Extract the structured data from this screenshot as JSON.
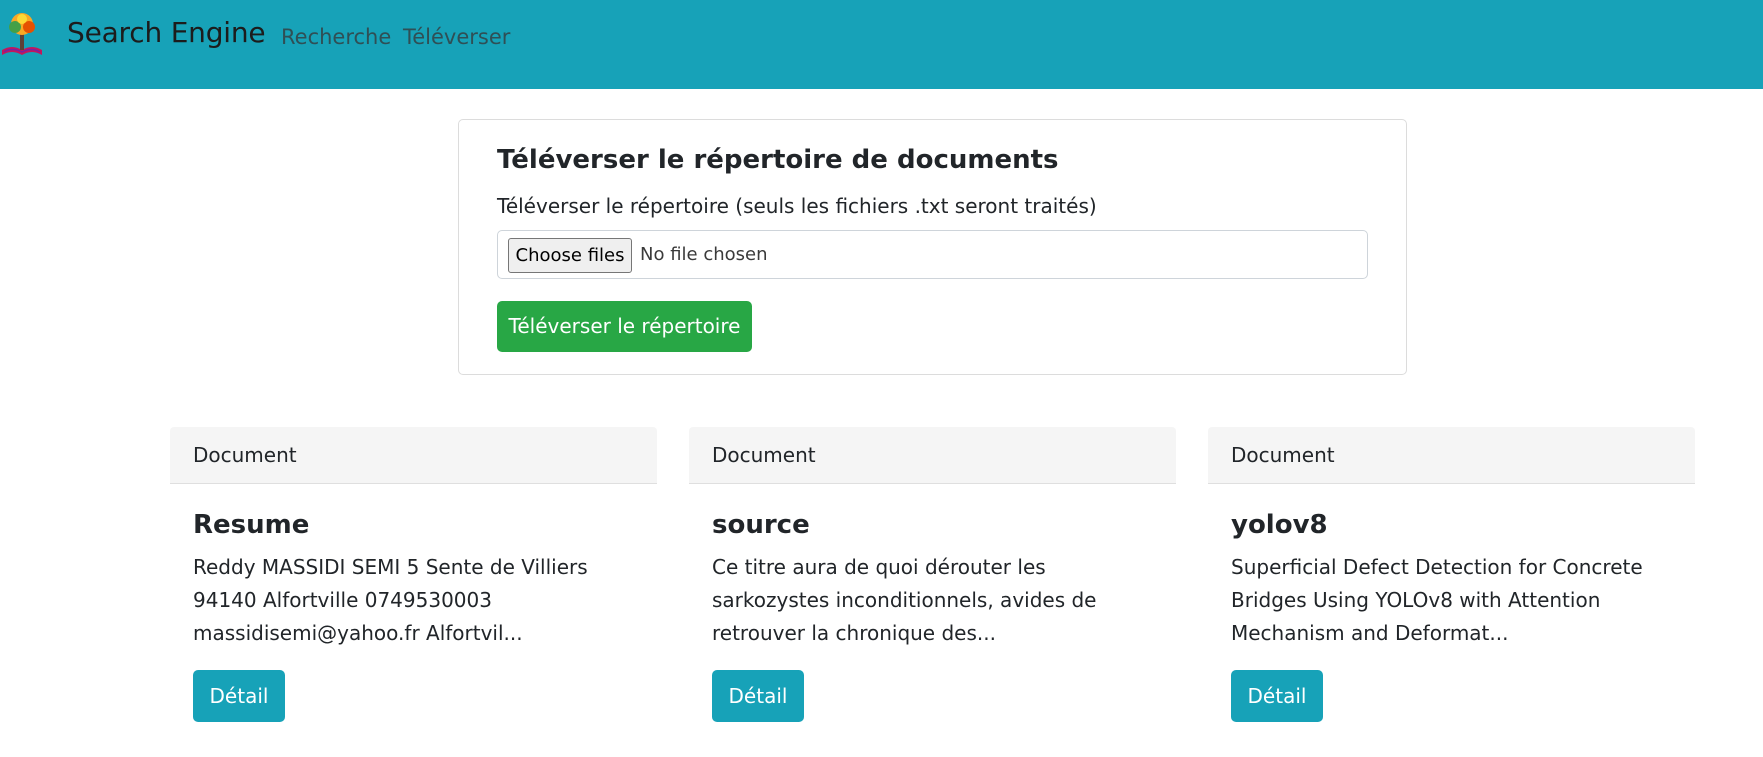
{
  "navbar": {
    "brand": "Search Engine",
    "logo_icon": "tree-book-logo",
    "links": [
      {
        "label": "Recherche"
      },
      {
        "label": "Téléverser"
      }
    ],
    "background_color": "#17a2b8"
  },
  "upload": {
    "title": "Téléverser le répertoire de documents",
    "label": "Téléverser le répertoire (seuls les fichiers .txt seront traités)",
    "file_button": "Choose files",
    "file_status": "No file chosen",
    "submit_label": "Téléverser le répertoire",
    "submit_color": "#28a745"
  },
  "documents": [
    {
      "header": "Document",
      "title": "Resume",
      "excerpt": "Reddy MASSIDI SEMI 5 Sente de Villiers 94140 Alfortville 0749530003 massidisemi@yahoo.fr Alfortvil...",
      "button": "Détail"
    },
    {
      "header": "Document",
      "title": "source",
      "excerpt": "Ce titre aura de quoi dérouter les sarkozystes inconditionnels, avides de retrouver la chronique des...",
      "button": "Détail"
    },
    {
      "header": "Document",
      "title": "yolov8",
      "excerpt": "Superficial Defect Detection for Concrete Bridges Using YOLOv8 with Attention Mechanism and Deformat...",
      "button": "Détail"
    }
  ],
  "detail_button_color": "#17a2b8"
}
